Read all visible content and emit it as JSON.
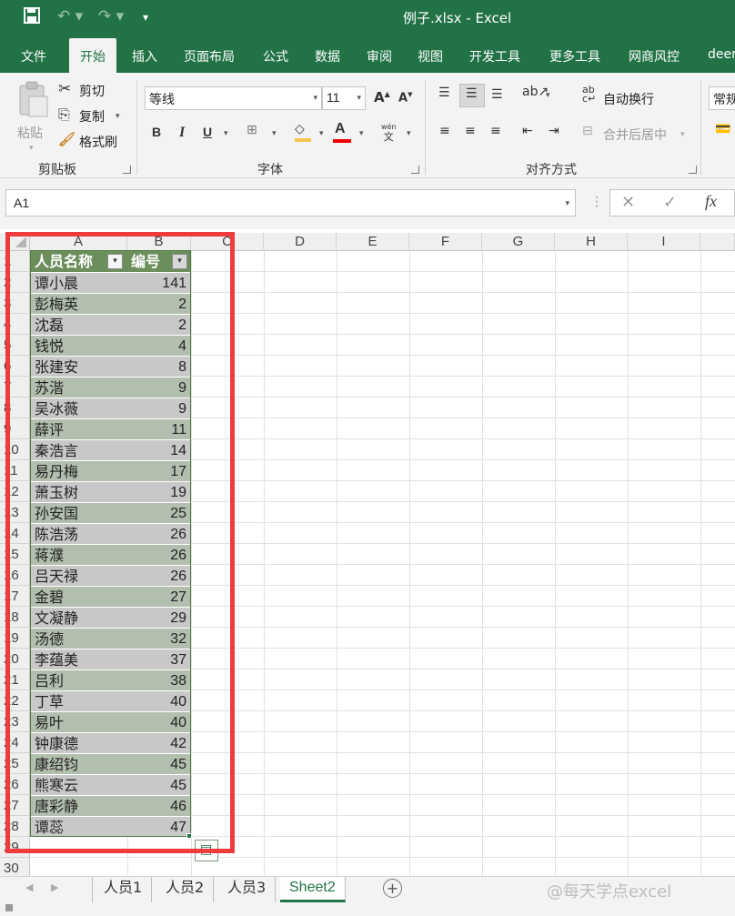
{
  "window": {
    "title": "例子.xlsx  -  Excel"
  },
  "menu": [
    "文件",
    "开始",
    "插入",
    "页面布局",
    "公式",
    "数据",
    "审阅",
    "视图",
    "开发工具",
    "更多工具",
    "网商风控",
    "deer"
  ],
  "ribbon": {
    "clipboard": {
      "paste": "粘贴",
      "cut": "剪切",
      "copy": "复制",
      "format_painter": "格式刷",
      "label": "剪贴板"
    },
    "font": {
      "name": "等线",
      "size": "11",
      "bold": "B",
      "italic": "I",
      "underline": "U",
      "label": "字体",
      "grow": "A",
      "shrink": "A",
      "color_letter": "A",
      "phonetic_top": "wén",
      "phonetic_bottom": "文"
    },
    "alignment": {
      "wrap_text": "自动换行",
      "merge_center": "合并后居中",
      "label": "对齐方式"
    },
    "number": {
      "format": "常规"
    }
  },
  "formula_bar": {
    "name_box": "A1",
    "fx": "fx"
  },
  "grid": {
    "columns": [
      "A",
      "B",
      "C",
      "D",
      "E",
      "F",
      "G",
      "H",
      "I"
    ],
    "rows": [
      "1",
      "2",
      "3",
      "4",
      "5",
      "6",
      "7",
      "8",
      "9",
      "10",
      "11",
      "12",
      "13",
      "14",
      "15",
      "16",
      "17",
      "18",
      "19",
      "20",
      "21",
      "22",
      "23",
      "24",
      "25",
      "26",
      "27",
      "28",
      "29",
      "30"
    ],
    "table_headers": [
      "人员名称",
      "编号"
    ],
    "table_rows": [
      [
        "谭小晨",
        "141"
      ],
      [
        "彭梅英",
        "2"
      ],
      [
        "沈磊",
        "2"
      ],
      [
        "钱悦",
        "4"
      ],
      [
        "张建安",
        "8"
      ],
      [
        "苏湝",
        "9"
      ],
      [
        "吴冰薇",
        "9"
      ],
      [
        "薛评",
        "11"
      ],
      [
        "秦浩言",
        "14"
      ],
      [
        "易丹梅",
        "17"
      ],
      [
        "萧玉树",
        "19"
      ],
      [
        "孙安国",
        "25"
      ],
      [
        "陈浩荡",
        "26"
      ],
      [
        "蒋濮",
        "26"
      ],
      [
        "吕天禄",
        "26"
      ],
      [
        "金碧",
        "27"
      ],
      [
        "文凝静",
        "29"
      ],
      [
        "汤德",
        "32"
      ],
      [
        "李蕴美",
        "37"
      ],
      [
        "吕利",
        "38"
      ],
      [
        "丁草",
        "40"
      ],
      [
        "易叶",
        "40"
      ],
      [
        "钟康德",
        "42"
      ],
      [
        "康绍钧",
        "45"
      ],
      [
        "熊寒云",
        "45"
      ],
      [
        "唐彩静",
        "46"
      ],
      [
        "谭蕊",
        "47"
      ]
    ]
  },
  "sheets": [
    "人员1",
    "人员2",
    "人员3",
    "Sheet2"
  ],
  "active_sheet": "Sheet2",
  "watermark": "@每天学点excel",
  "colors": {
    "accent": "#217346",
    "highlight_box": "#ee3b3b",
    "table_header": "#6b8e5a",
    "band_a": "#b3bfae",
    "band_b": "#c8c8c8"
  }
}
